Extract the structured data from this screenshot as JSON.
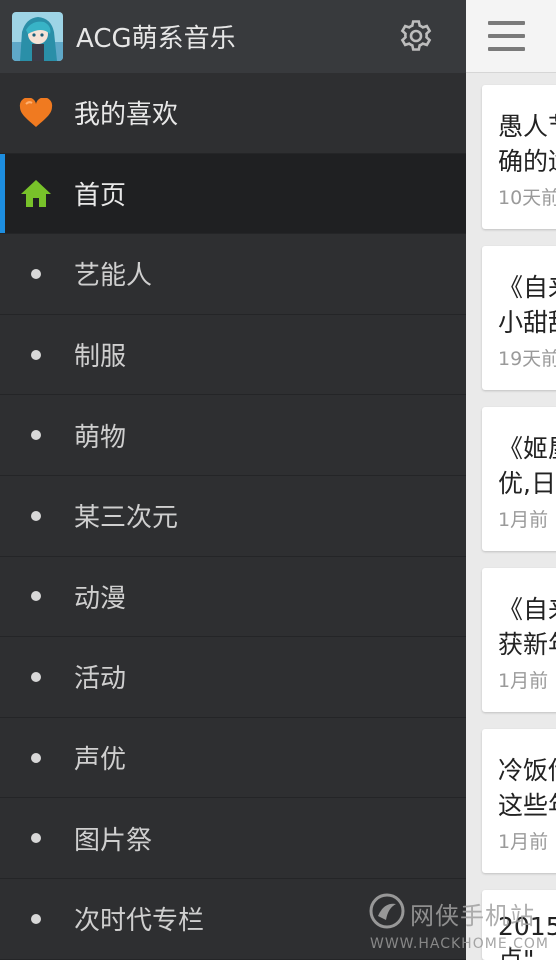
{
  "app": {
    "title": "ACG萌系音乐",
    "logo_icon": "anime-avatar-logo",
    "settings_icon": "gear-icon"
  },
  "drawer": {
    "items": [
      {
        "label": "我的喜欢",
        "icon": "heart-icon",
        "active": false
      },
      {
        "label": "首页",
        "icon": "home-icon",
        "active": true
      },
      {
        "label": "艺能人",
        "icon": "bullet-icon",
        "active": false
      },
      {
        "label": "制服",
        "icon": "bullet-icon",
        "active": false
      },
      {
        "label": "萌物",
        "icon": "bullet-icon",
        "active": false
      },
      {
        "label": "某三次元",
        "icon": "bullet-icon",
        "active": false
      },
      {
        "label": "动漫",
        "icon": "bullet-icon",
        "active": false
      },
      {
        "label": "活动",
        "icon": "bullet-icon",
        "active": false
      },
      {
        "label": "声优",
        "icon": "bullet-icon",
        "active": false
      },
      {
        "label": "图片祭",
        "icon": "bullet-icon",
        "active": false
      },
      {
        "label": "次时代专栏",
        "icon": "bullet-icon",
        "active": false
      }
    ],
    "active_color": "#1d8ee0",
    "heart_color": "#f07a20",
    "home_color": "#78c22a"
  },
  "content": {
    "menu_icon": "hamburger-icon",
    "cards": [
      {
        "line1": "愚人节",
        "line2": "确的适",
        "time": "10天前"
      },
      {
        "line1": "《自来",
        "line2": "小甜甜",
        "time": "19天前"
      },
      {
        "line1": "《姬屋",
        "line2": "优,日",
        "time": "1月前"
      },
      {
        "line1": "《自来",
        "line2": "获新年",
        "time": "1月前"
      },
      {
        "line1": "冷饭传",
        "line2": "这些年",
        "time": "1月前"
      },
      {
        "line1": "2015",
        "line2": "点\"",
        "time": ""
      }
    ]
  },
  "watermark": {
    "text": "网侠手机站",
    "url": "WWW.HACKHOME.COM"
  }
}
